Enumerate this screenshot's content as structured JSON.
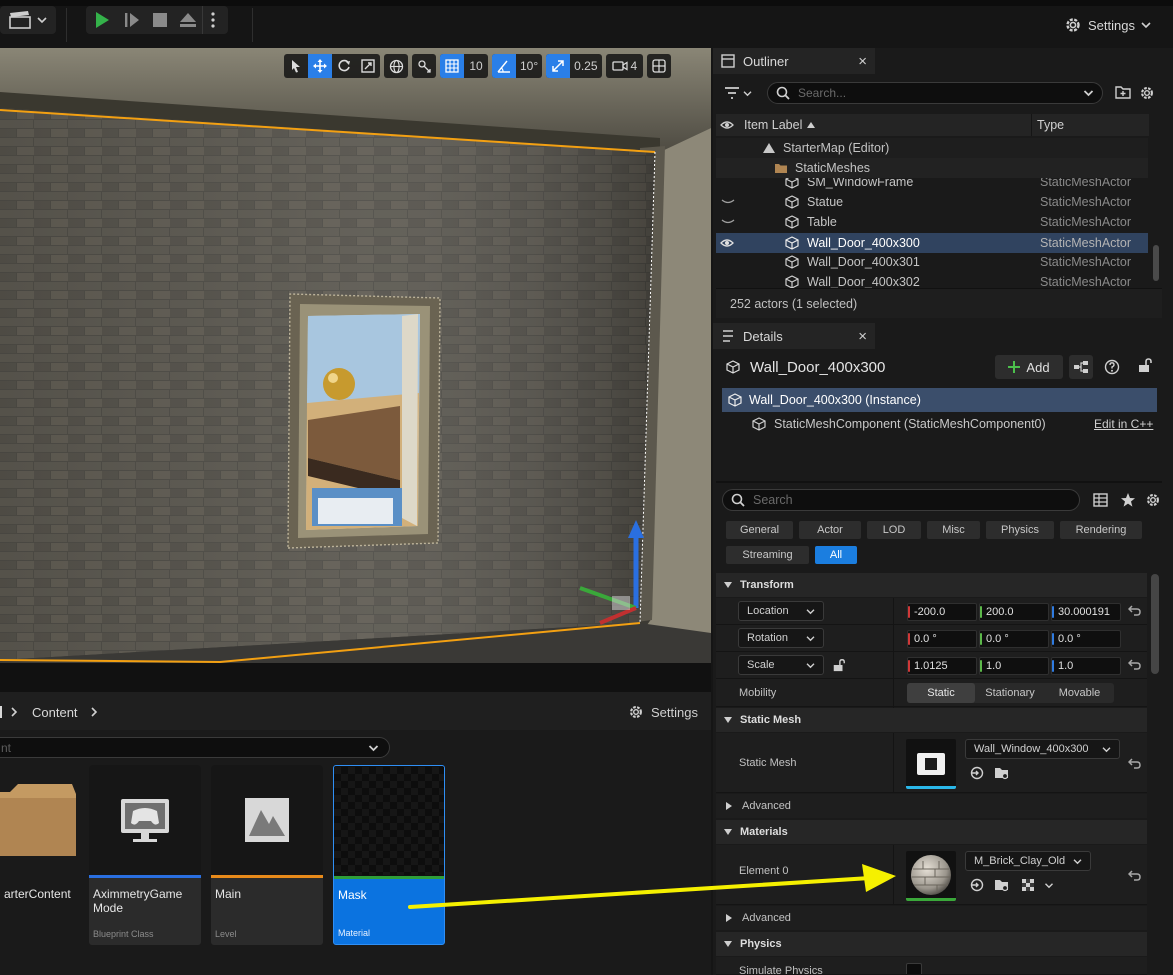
{
  "toolbar": {
    "settings_label": "Settings"
  },
  "viewport_toolbar": {
    "grid_snap_value": "10",
    "rotation_snap_value": "10°",
    "scale_snap_value": "0.25",
    "camera_speed_value": "4"
  },
  "outliner": {
    "tab_title": "Outliner",
    "search_placeholder": "Search...",
    "col_item_label": "Item Label",
    "col_type": "Type",
    "rows": [
      {
        "label": "StarterMap (Editor)",
        "type": ""
      },
      {
        "label": "StaticMeshes",
        "type": ""
      },
      {
        "label": "SM_WindowFrame",
        "type": "StaticMeshActor"
      },
      {
        "label": "Statue",
        "type": "StaticMeshActor"
      },
      {
        "label": "Table",
        "type": "StaticMeshActor"
      },
      {
        "label": "Wall_Door_400x300",
        "type": "StaticMeshActor"
      },
      {
        "label": "Wall_Door_400x301",
        "type": "StaticMeshActor"
      },
      {
        "label": "Wall_Door_400x302",
        "type": "StaticMeshActor"
      }
    ],
    "status": "252 actors (1 selected)"
  },
  "details": {
    "tab_title": "Details",
    "actor_name": "Wall_Door_400x300",
    "add_label": "Add",
    "instance_label": "Wall_Door_400x300 (Instance)",
    "component_label": "StaticMeshComponent (StaticMeshComponent0)",
    "edit_cpp": "Edit in C++",
    "search_placeholder": "Search",
    "filters": [
      "General",
      "Actor",
      "LOD",
      "Misc",
      "Physics",
      "Rendering",
      "Streaming",
      "All"
    ],
    "transform": {
      "section": "Transform",
      "location_label": "Location",
      "location": [
        "-200.0",
        "200.0",
        "30.000191"
      ],
      "rotation_label": "Rotation",
      "rotation": [
        "0.0 °",
        "0.0 °",
        "0.0 °"
      ],
      "scale_label": "Scale",
      "scale": [
        "1.0125",
        "1.0",
        "1.0"
      ],
      "mobility_label": "Mobility",
      "mobility_options": [
        "Static",
        "Stationary",
        "Movable"
      ]
    },
    "static_mesh": {
      "section": "Static Mesh",
      "label": "Static Mesh",
      "value": "Wall_Window_400x300",
      "advanced": "Advanced"
    },
    "materials": {
      "section": "Materials",
      "element_label": "Element 0",
      "value": "M_Brick_Clay_Old",
      "advanced": "Advanced"
    },
    "physics": {
      "section": "Physics",
      "simulate_label": "Simulate Physics"
    }
  },
  "content_browser": {
    "breadcrumb_root": "Content",
    "settings_label": "Settings",
    "search_partial": "nt",
    "assets": [
      {
        "name": "arterContent",
        "kind": ""
      },
      {
        "name": "AximmetryGame Mode",
        "kind": "Blueprint Class"
      },
      {
        "name": "Main",
        "kind": "Level"
      },
      {
        "name": "Mask",
        "kind": "Material"
      }
    ]
  },
  "colors": {
    "accent": "#1b7ee0",
    "play_green": "#34b24a",
    "selection_outline": "#f3a012",
    "arrow": "#f5f000"
  }
}
